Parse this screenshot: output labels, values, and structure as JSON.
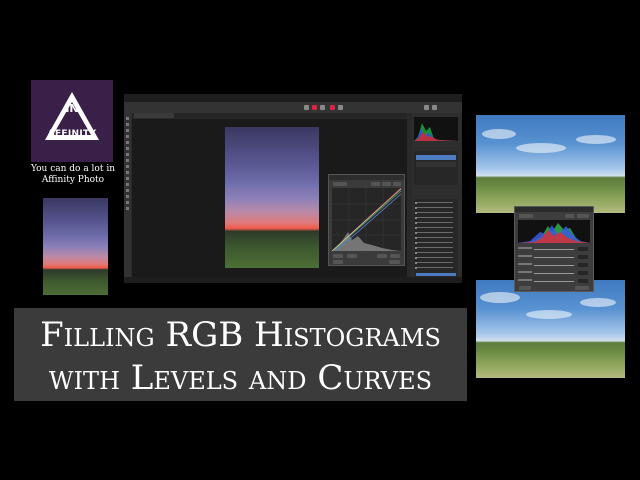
{
  "logo": {
    "line1": "IN",
    "line2": "AFFINITY"
  },
  "tagline": "You can do a lot in Affinity Photo",
  "headline": {
    "line1": "Filling RGB Histograms",
    "line2": "with Levels and Curves"
  },
  "colors": {
    "logo_background": "#3a1f48",
    "headline_background": "#3b3b3b",
    "page_background": "#000000",
    "selection_blue": "#4d7bc4"
  },
  "icons": [
    "affinity-triangle-logo",
    "curves-line",
    "rgb-histogram"
  ]
}
